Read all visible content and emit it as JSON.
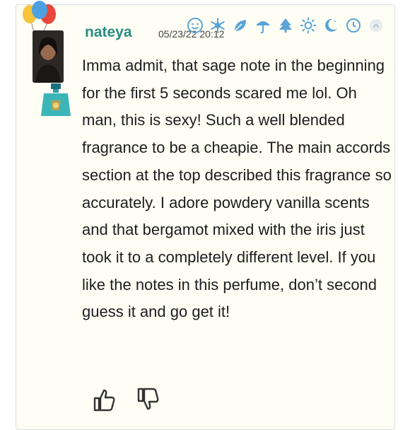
{
  "review": {
    "username": "nateya",
    "date": "05/23/22 20:12",
    "text": "Imma admit, that sage note in the beginning for the first 5 seconds scared me lol. Oh man, this is sexy! Such a well blended fragrance to be a cheapie. The main accords section at the top described this fragrance so accurately. I adore powdery vanilla scents and that bergamot mixed with the iris just took it to a completely different level. If you like the notes in this perfume, don’t second guess it and go get it!"
  },
  "season_icons": [
    "smiley-icon",
    "snowflake-icon",
    "leaf-icon",
    "umbrella-icon",
    "tree-icon",
    "sun-icon",
    "moon-icon",
    "clock-icon",
    "circle-icon"
  ],
  "colors": {
    "accent": "#2a8c80",
    "card_bg": "#fefef4",
    "icon_blue": "#5aa4d6"
  }
}
